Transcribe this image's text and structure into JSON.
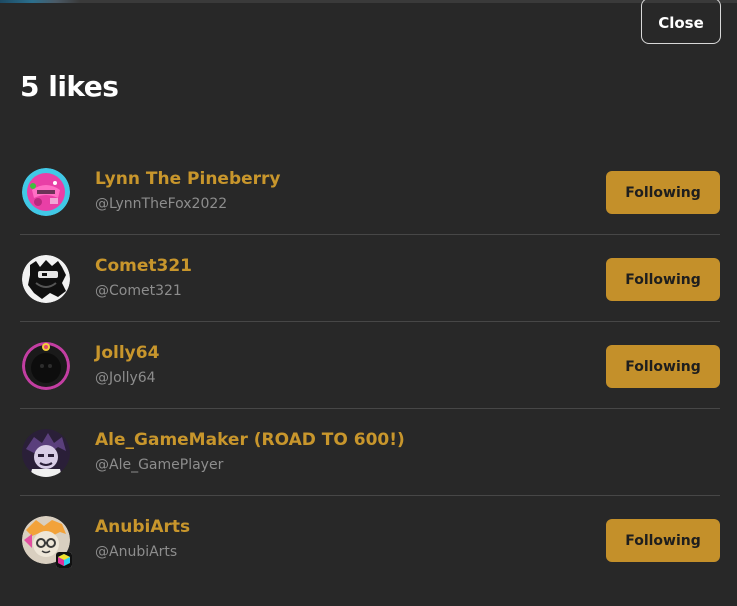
{
  "modal": {
    "close_label": "Close",
    "title": "5 likes"
  },
  "likes": [
    {
      "name": "Lynn The Pineberry",
      "handle": "@LynnTheFox2022",
      "button": "Following",
      "avatar": "pink-character-avatar"
    },
    {
      "name": "Comet321",
      "handle": "@Comet321",
      "button": "Following",
      "avatar": "black-white-character-avatar"
    },
    {
      "name": "Jolly64",
      "handle": "@Jolly64",
      "button": "Following",
      "avatar": "dark-pink-ring-avatar"
    },
    {
      "name": "Ale_GameMaker (ROAD TO 600!)",
      "handle": "@Ale_GamePlayer",
      "button": "",
      "avatar": "purple-character-avatar"
    },
    {
      "name": "AnubiArts",
      "handle": "@AnubiArts",
      "button": "Following",
      "avatar": "glasses-character-avatar"
    }
  ],
  "colors": {
    "background": "#282828",
    "accent": "#c4902a",
    "name": "#c8962c",
    "handle": "#8d8d8d",
    "divider": "#474747"
  }
}
